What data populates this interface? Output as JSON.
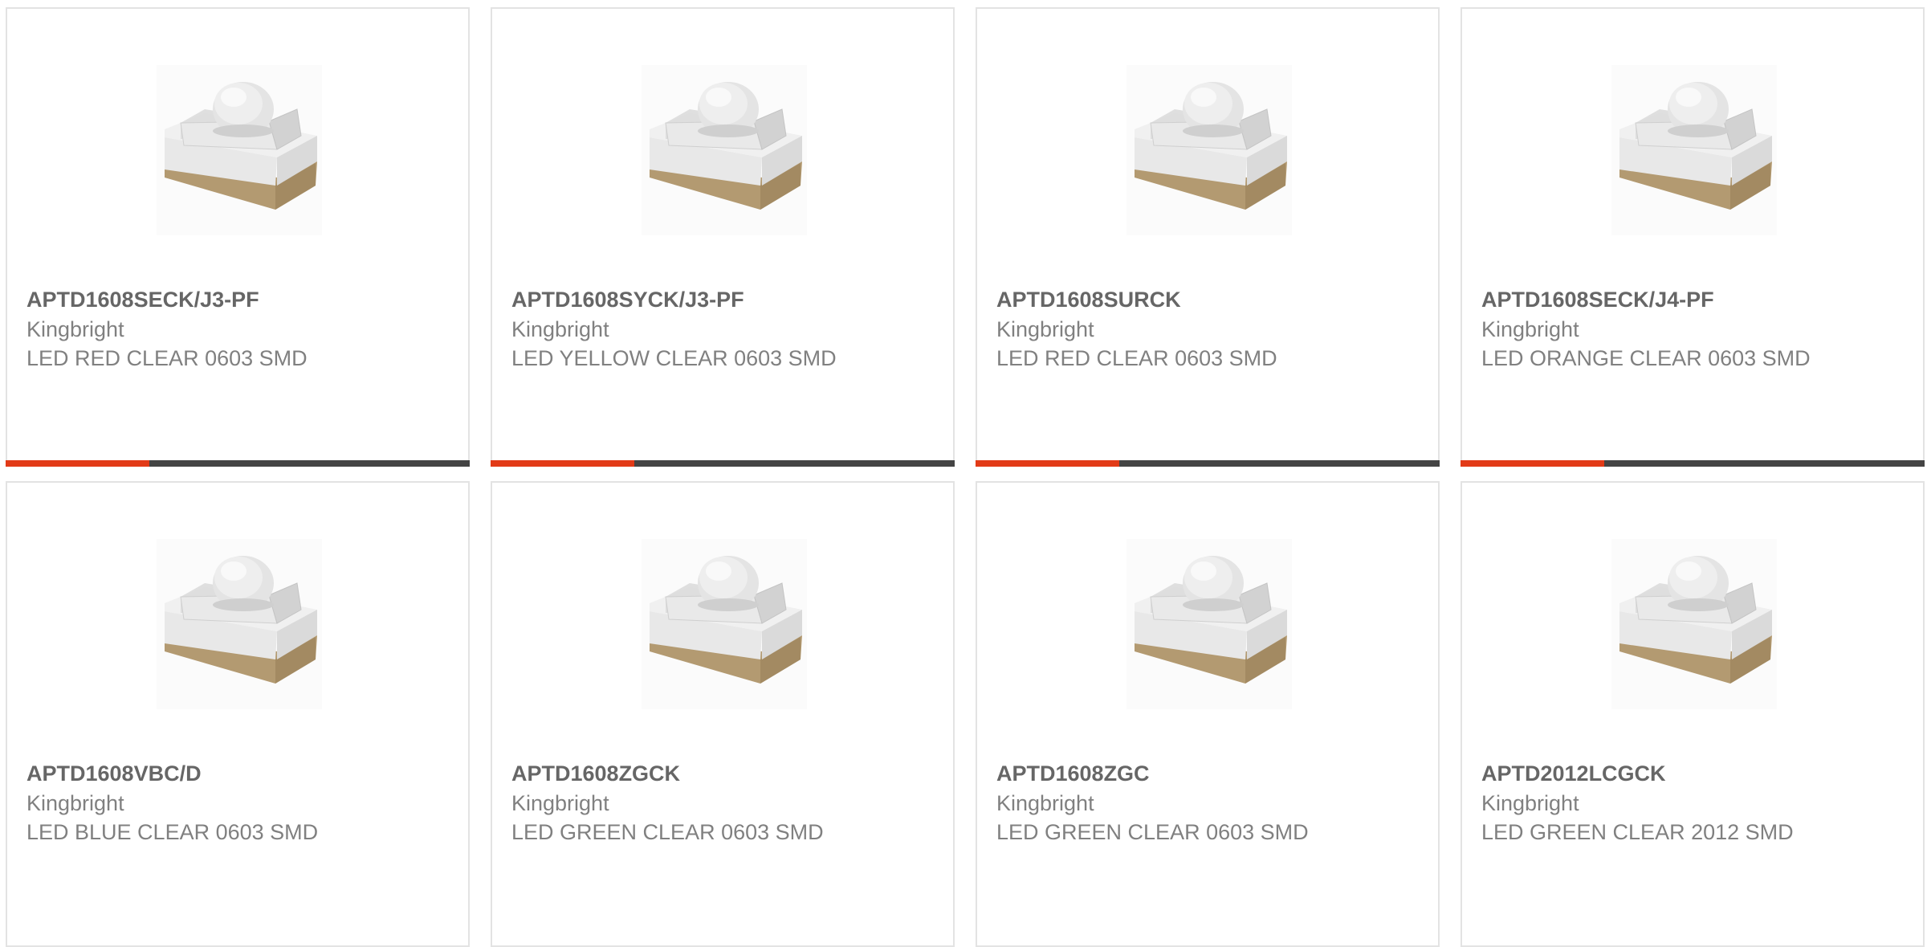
{
  "colors": {
    "accent": "#e23a17",
    "bar_dark": "#444444",
    "card_border": "#e3e3e3",
    "part_text": "#666666",
    "secondary_text": "#808080"
  },
  "products": [
    {
      "part_number": "APTD1608SECK/J3-PF",
      "manufacturer": "Kingbright",
      "description": "LED RED CLEAR 0603 SMD",
      "image_icon": "smd-led-package-image",
      "show_bar": true,
      "progress_fraction": 0.31
    },
    {
      "part_number": "APTD1608SYCK/J3-PF",
      "manufacturer": "Kingbright",
      "description": "LED YELLOW CLEAR 0603 SMD",
      "image_icon": "smd-led-package-image",
      "show_bar": true,
      "progress_fraction": 0.31
    },
    {
      "part_number": "APTD1608SURCK",
      "manufacturer": "Kingbright",
      "description": "LED RED CLEAR 0603 SMD",
      "image_icon": "smd-led-package-image",
      "show_bar": true,
      "progress_fraction": 0.31
    },
    {
      "part_number": "APTD1608SECK/J4-PF",
      "manufacturer": "Kingbright",
      "description": "LED ORANGE CLEAR 0603 SMD",
      "image_icon": "smd-led-package-image",
      "show_bar": true,
      "progress_fraction": 0.31
    },
    {
      "part_number": "APTD1608VBC/D",
      "manufacturer": "Kingbright",
      "description": "LED BLUE CLEAR 0603 SMD",
      "image_icon": "smd-led-package-image",
      "show_bar": false
    },
    {
      "part_number": "APTD1608ZGCK",
      "manufacturer": "Kingbright",
      "description": "LED GREEN CLEAR 0603 SMD",
      "image_icon": "smd-led-package-image",
      "show_bar": false
    },
    {
      "part_number": "APTD1608ZGC",
      "manufacturer": "Kingbright",
      "description": "LED GREEN CLEAR 0603 SMD",
      "image_icon": "smd-led-package-image",
      "show_bar": false
    },
    {
      "part_number": "APTD2012LCGCK",
      "manufacturer": "Kingbright",
      "description": "LED GREEN CLEAR 2012 SMD",
      "image_icon": "smd-led-package-image",
      "show_bar": false
    }
  ]
}
